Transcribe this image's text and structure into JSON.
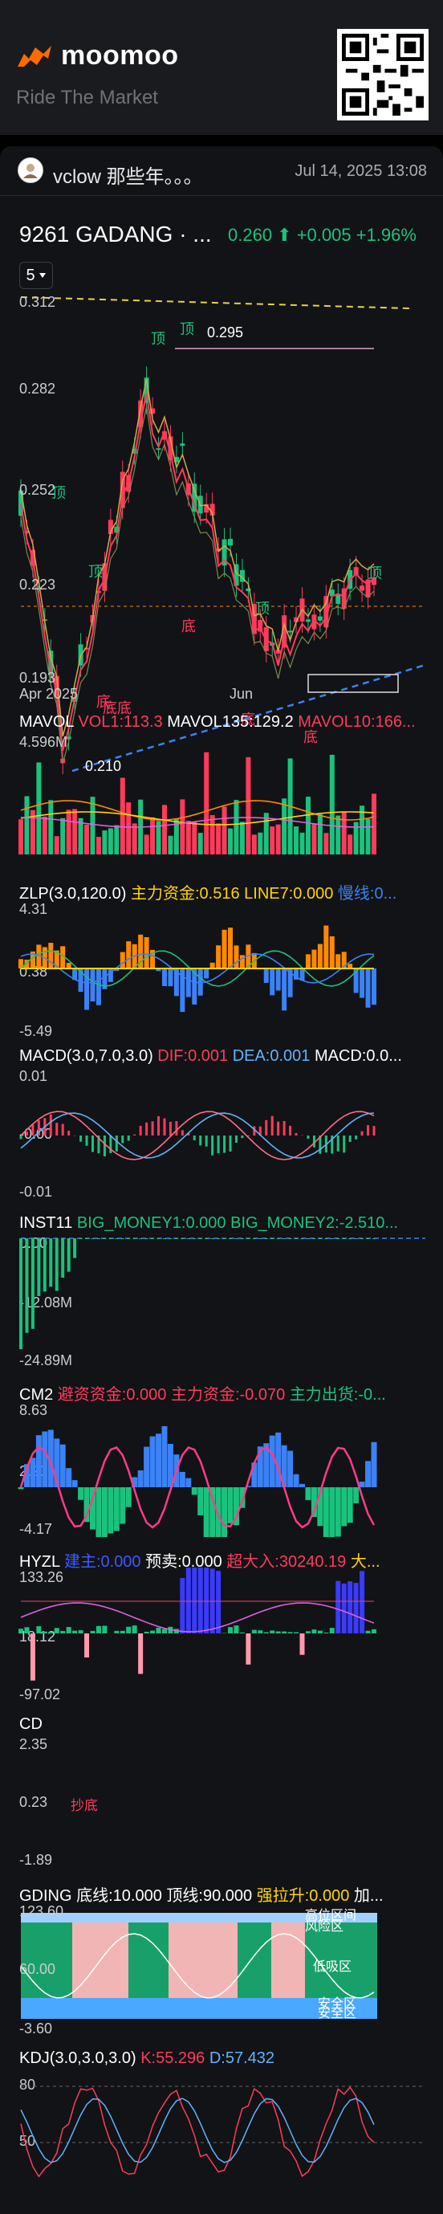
{
  "brand": {
    "name": "moomoo",
    "tagline": "Ride The Market"
  },
  "post": {
    "username": "vclow 那些年。。。",
    "date": "Jul 14, 2025 13:08"
  },
  "stock": {
    "name": "9261 GADANG · ...",
    "price": "0.260 ⬆ +0.005 +1.96%",
    "price_color": "#19c37d"
  },
  "chart_period": "5",
  "chart_data": [
    {
      "type": "line",
      "title": "",
      "y_ticks": [
        "0.312",
        "0.282",
        "0.252",
        "0.223",
        "0.193"
      ],
      "x_ticks": [
        "Apr 2025",
        "Jun"
      ],
      "annotations": [
        "0.295",
        "0.210",
        "顶",
        "顶",
        "顶",
        "顶",
        "顶",
        "顶",
        "底",
        "底底",
        "底",
        "底",
        "底"
      ]
    },
    {
      "type": "bar",
      "title": "MAVOL",
      "legend": [
        "VOL1:113.3",
        "MAVOL135:129.2",
        "MAVOL10:166..."
      ],
      "y_ticks": [
        "4.596M"
      ]
    },
    {
      "type": "bar",
      "title": "ZLP(3.0,120.0)",
      "legend": [
        "主力资金:0.516",
        "LINE7:0.000",
        "慢线:0..."
      ],
      "y_ticks": [
        "4.31",
        "0.38",
        "-5.49"
      ]
    },
    {
      "type": "bar",
      "title": "MACD(3.0,7.0,3.0)",
      "legend": [
        "DIF:0.001",
        "DEA:0.001",
        "MACD:0.0..."
      ],
      "y_ticks": [
        "0.01",
        "-0.00",
        "-0.01"
      ]
    },
    {
      "type": "bar",
      "title": "INST11",
      "legend": [
        "BIG_MONEY1:0.000",
        "BIG_MONEY2:-2.510..."
      ],
      "y_ticks": [
        "0.00",
        "-12.08M",
        "-24.89M"
      ]
    },
    {
      "type": "bar",
      "title": "CM2",
      "legend": [
        "避资资金:0.000",
        "主力资金:-0.070",
        "主力出货:-0..."
      ],
      "y_ticks": [
        "8.63",
        "2.23",
        "-4.17"
      ]
    },
    {
      "type": "bar",
      "title": "HYZL",
      "legend": [
        "建主:0.000",
        "预卖:0.000",
        "超大入:30240.19",
        "大..."
      ],
      "y_ticks": [
        "133.26",
        "18.12",
        "-97.02"
      ]
    },
    {
      "type": "line",
      "title": "CD",
      "y_ticks": [
        "2.35",
        "0.23",
        "-1.89"
      ],
      "annotations": [
        "抄底"
      ]
    },
    {
      "type": "bar",
      "title": "GDING",
      "legend": [
        "底线:10.000",
        "顶线:90.000",
        "强拉升:0.000",
        "加..."
      ],
      "y_ticks": [
        "123.60",
        "60.00",
        "-3.60"
      ],
      "annotations": [
        "高位区间",
        "风险区",
        "低吸区",
        "安全区",
        "安全区"
      ]
    },
    {
      "type": "line",
      "title": "KDJ(3.0,3.0,3.0)",
      "legend": [
        "K:55.296",
        "D:57.432"
      ],
      "y_ticks": [
        "80",
        "50"
      ]
    }
  ],
  "colors": {
    "up": "#19c37d",
    "down": "#ff3b5c",
    "blue": "#3b82f6",
    "orange": "#ff8a00",
    "yellow": "#ffd400"
  }
}
